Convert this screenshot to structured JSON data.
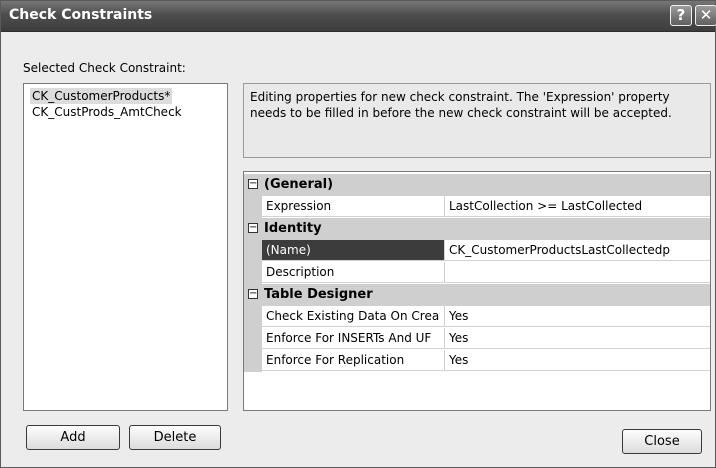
{
  "window": {
    "title": "Check Constraints",
    "help_glyph": "?",
    "close_glyph": "✕"
  },
  "selected_label": "Selected Check Constraint:",
  "constraints": [
    {
      "label": "CK_CustomerProducts*",
      "selected": true
    },
    {
      "label": "CK_CustProds_AmtCheck",
      "selected": false
    }
  ],
  "description": "Editing properties for new check constraint.  The 'Expression' property needs to be filled in before the new check constraint will be accepted.",
  "properties": {
    "general": {
      "toggle": "⊟",
      "title": "(General)",
      "expression": {
        "name": "Expression",
        "value": "LastCollection >= LastCollected"
      }
    },
    "identity": {
      "toggle": "⊟",
      "title": "Identity",
      "name": {
        "name": "(Name)",
        "value": "CK_CustomerProductsLastCollectedp"
      },
      "description": {
        "name": "Description",
        "value": ""
      }
    },
    "table_designer": {
      "toggle": "⊟",
      "title": "Table Designer",
      "check_existing": {
        "name": "Check Existing Data On Crea",
        "value": "Yes"
      },
      "enforce_inserts": {
        "name": "Enforce For INSERTs And UF",
        "value": "Yes"
      },
      "enforce_replication": {
        "name": "Enforce For Replication",
        "value": "Yes"
      }
    }
  },
  "buttons": {
    "add": "Add",
    "delete": "Delete",
    "close": "Close"
  }
}
